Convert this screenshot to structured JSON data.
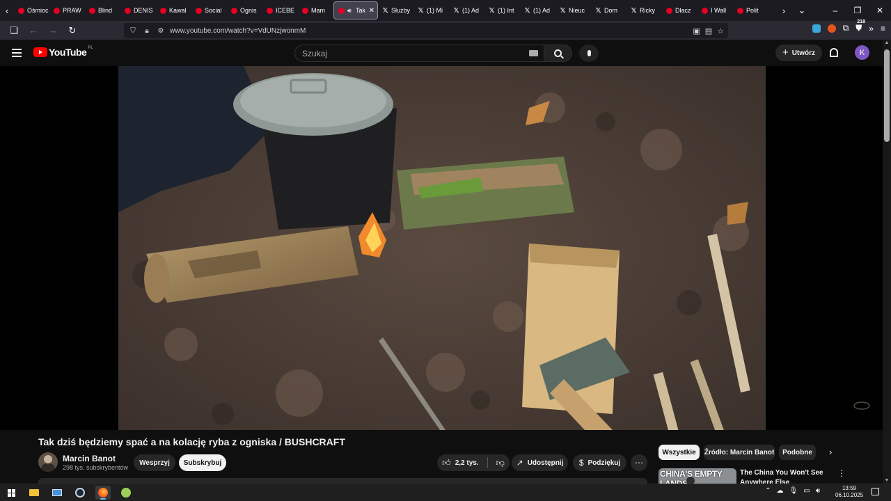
{
  "browser": {
    "tabs": [
      {
        "label": "Ośmioc",
        "icon": "youtube"
      },
      {
        "label": "PRAW",
        "icon": "youtube"
      },
      {
        "label": "Blind",
        "icon": "youtube"
      },
      {
        "label": "DENIS",
        "icon": "youtube"
      },
      {
        "label": "Kawal",
        "icon": "youtube"
      },
      {
        "label": "Social",
        "icon": "youtube"
      },
      {
        "label": "Ognis",
        "icon": "youtube"
      },
      {
        "label": "ICEBE",
        "icon": "youtube"
      },
      {
        "label": "Mam",
        "icon": "youtube"
      },
      {
        "label": "Tak",
        "icon": "youtube",
        "active": true,
        "playing": true
      },
      {
        "label": "Służby",
        "icon": "x"
      },
      {
        "label": "(1) Mi",
        "icon": "x"
      },
      {
        "label": "(1) Ad",
        "icon": "x"
      },
      {
        "label": "(1) Int",
        "icon": "x"
      },
      {
        "label": "(1) Ad",
        "icon": "x"
      },
      {
        "label": "Nieuc",
        "icon": "x"
      },
      {
        "label": "Dom",
        "icon": "x"
      },
      {
        "label": "Ricky",
        "icon": "x"
      },
      {
        "label": "Dlacz",
        "icon": "youtube"
      },
      {
        "label": "I Wall",
        "icon": "youtube"
      },
      {
        "label": "Polit",
        "icon": "youtube"
      }
    ],
    "url": "www.youtube.com/watch?v=VdUNzjwonmM",
    "extension_badge": "218"
  },
  "youtube": {
    "logo_text": "YouTube",
    "country_code": "PL",
    "search_placeholder": "Szukaj",
    "create_label": "Utwórz",
    "avatar_letter": "K"
  },
  "video": {
    "title": "Tak dziś będziemy spać a na kolację ryba z ogniska / BUSHCRAFT",
    "channel_name": "Marcin Banot",
    "subscribers": "298 tys. subskrybentów",
    "join_label": "Wesprzyj",
    "subscribe_label": "Subskrybuj",
    "likes": "2,2 tys.",
    "share_label": "Udostępnij",
    "thanks_label": "Podziękuj"
  },
  "sidebar": {
    "chips": [
      "Wszystkie",
      "Źródło: Marcin Banot",
      "Podobne"
    ],
    "recommendation": {
      "thumb_text": "CHINA'S EMPTY LANDS",
      "title": "The China You Won't See Anywhere Else"
    }
  },
  "taskbar": {
    "time": "13:59",
    "date": "06.10.2025"
  }
}
